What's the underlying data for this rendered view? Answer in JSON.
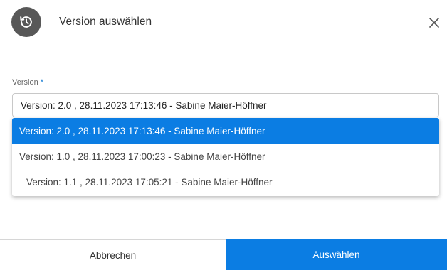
{
  "dialog": {
    "title": "Version auswählen",
    "header_icon": "history-icon",
    "close_icon": "close-icon"
  },
  "field": {
    "label": "Version",
    "required_marker": "*",
    "selected_value": "Version: 2.0 , 28.11.2023 17:13:46 - Sabine Maier-Höffner"
  },
  "dropdown": {
    "options": [
      {
        "label": "Version: 2.0 , 28.11.2023 17:13:46 - Sabine Maier-Höffner",
        "selected": true,
        "indented": false
      },
      {
        "label": "Version: 1.0 , 28.11.2023 17:00:23 - Sabine Maier-Höffner",
        "selected": false,
        "indented": false
      },
      {
        "label": "Version: 1.1 , 28.11.2023 17:05:21 - Sabine Maier-Höffner",
        "selected": false,
        "indented": true
      }
    ]
  },
  "footer": {
    "cancel_label": "Abbrechen",
    "confirm_label": "Auswählen"
  },
  "colors": {
    "accent": "#0b7de3",
    "header_icon_bg": "#585858"
  }
}
